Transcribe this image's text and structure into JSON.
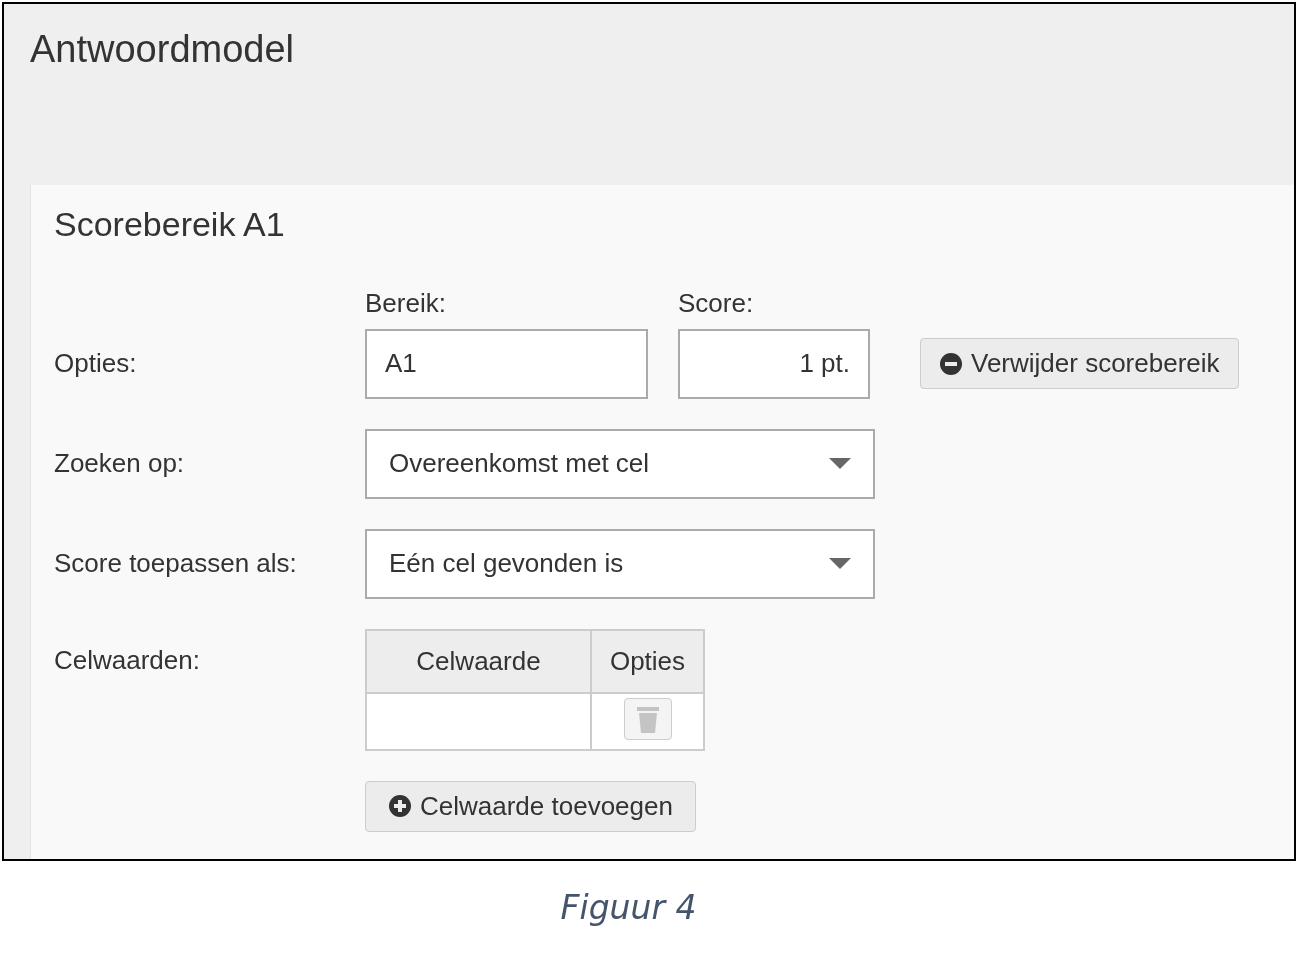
{
  "window": {
    "title": "Antwoordmodel"
  },
  "section": {
    "title": "Scorebereik A1",
    "options": {
      "label": "Opties:",
      "range_field": {
        "label": "Bereik:",
        "value": "A1"
      },
      "score_field": {
        "label": "Score:",
        "value": "1 pt."
      },
      "remove_button": "Verwijder scorebereik"
    },
    "search_by": {
      "label": "Zoeken op:",
      "value": "Overeenkomst met cel"
    },
    "apply_score_as": {
      "label": "Score toepassen als:",
      "value": "Eén cel gevonden is"
    },
    "cell_values": {
      "label": "Celwaarden:",
      "columns": [
        "Celwaarde",
        "Opties"
      ],
      "add_button": "Celwaarde toevoegen"
    }
  },
  "caption": "Figuur 4"
}
